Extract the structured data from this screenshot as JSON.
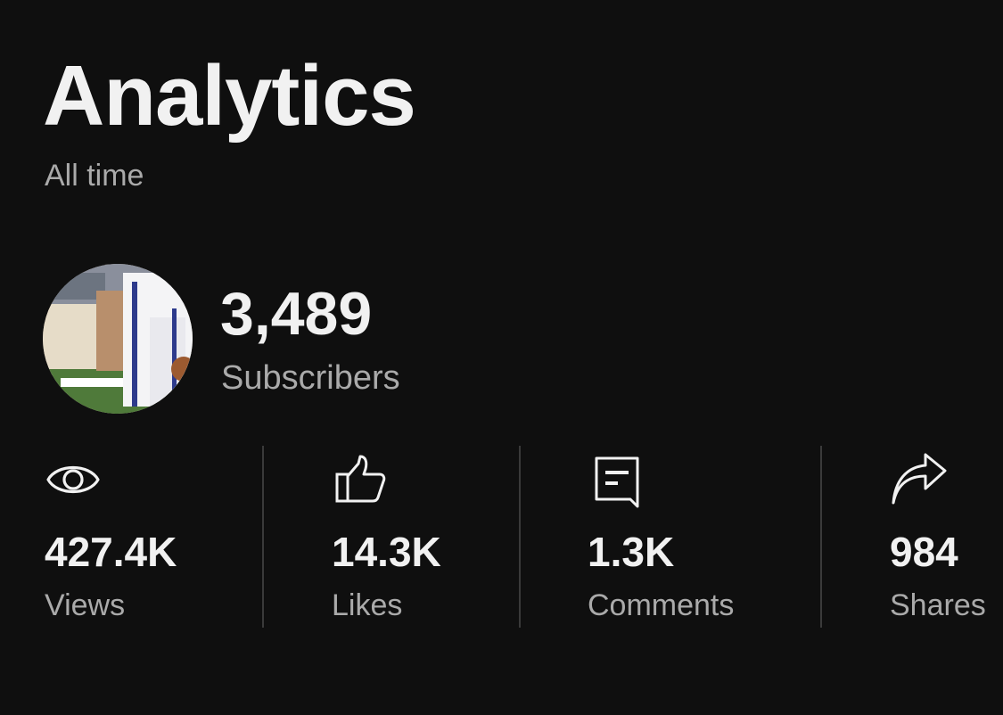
{
  "header": {
    "title": "Analytics",
    "period": "All time"
  },
  "channel": {
    "subscriber_count": "3,489",
    "subscriber_label": "Subscribers"
  },
  "stats": [
    {
      "icon": "eye-icon",
      "value": "427.4K",
      "label": "Views"
    },
    {
      "icon": "thumbs-up-icon",
      "value": "14.3K",
      "label": "Likes"
    },
    {
      "icon": "comment-icon",
      "value": "1.3K",
      "label": "Comments"
    },
    {
      "icon": "share-icon",
      "value": "984",
      "label": "Shares"
    }
  ],
  "colors": {
    "background": "#0f0f0f",
    "primary_text": "#f1f1f1",
    "secondary_text": "#aaaaaa",
    "divider": "#3a3a3a"
  }
}
